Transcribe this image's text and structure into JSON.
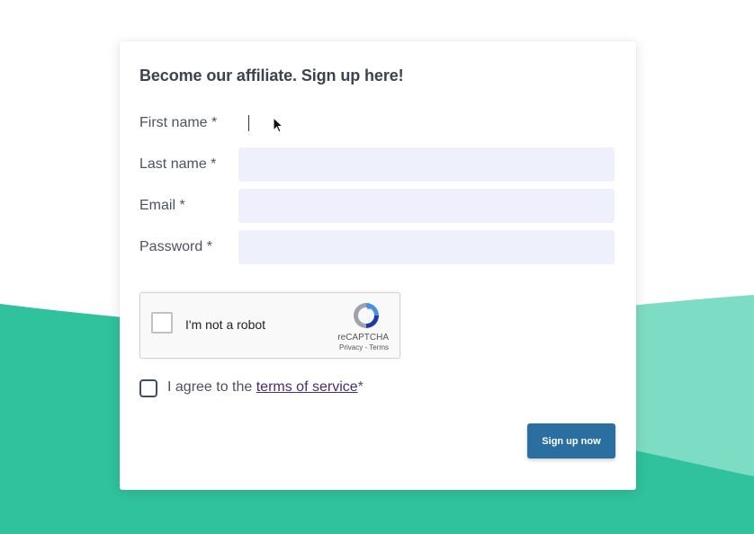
{
  "colors": {
    "accent_green": "#2fc29c",
    "accent_green_light": "#7ddcc4",
    "button": "#2b6fa0",
    "field_bg": "#eef1fb",
    "link": "#4a2c6e"
  },
  "form": {
    "title": "Become our affiliate. Sign up here!",
    "fields": [
      {
        "label": "First name *",
        "value": "",
        "placeholder": ""
      },
      {
        "label": "Last name *",
        "value": "",
        "placeholder": ""
      },
      {
        "label": "Email *",
        "value": "",
        "placeholder": ""
      },
      {
        "label": "Password *",
        "value": "",
        "placeholder": ""
      }
    ],
    "recaptcha": {
      "label": "I'm not a robot",
      "brand": "reCAPTCHA",
      "links": "Privacy - Terms",
      "icon": "recaptcha-logo-icon"
    },
    "agree": {
      "prefix": "I agree to the ",
      "link_text": "terms of service",
      "suffix": "*"
    },
    "submit_label": "Sign up now"
  }
}
